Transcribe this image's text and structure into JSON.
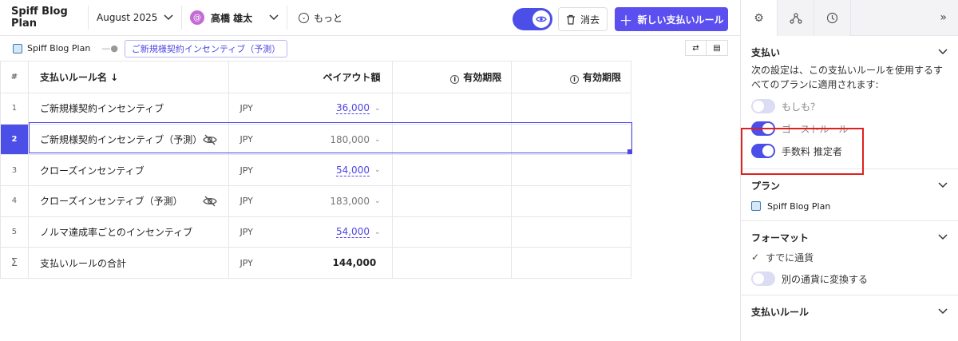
{
  "topbar": {
    "title": "Spiff Blog Plan",
    "month": "August 2025",
    "user_name": "高橋 雄太",
    "more_label": "もっと",
    "delete_label": "消去",
    "new_rule_label": "新しい支払いルール"
  },
  "breadcrumb": {
    "plan": "Spiff Blog Plan",
    "current": "ご新規様契約インセンティブ（予測）"
  },
  "table": {
    "headers": {
      "num": "#",
      "name": "支払いルール名 ↓",
      "payout": "ペイアウト額",
      "valid1": "有効期限",
      "valid2": "有効期限"
    },
    "rows": [
      {
        "num": "1",
        "name": "ご新規様契約インセンティブ",
        "currency": "JPY",
        "amount": "36,000"
      },
      {
        "num": "2",
        "name": "ご新規様契約インセンティブ（予測）",
        "currency": "JPY",
        "amount": "180,000"
      },
      {
        "num": "3",
        "name": "クローズインセンティブ",
        "currency": "JPY",
        "amount": "54,000"
      },
      {
        "num": "4",
        "name": "クローズインセンティブ（予測）",
        "currency": "JPY",
        "amount": "183,000"
      },
      {
        "num": "5",
        "name": "ノルマ達成率ごとのインセンティブ",
        "currency": "JPY",
        "amount": "54,000"
      }
    ],
    "total": {
      "symbol": "Σ",
      "name": "支払いルールの合計",
      "currency": "JPY",
      "amount": "144,000"
    }
  },
  "panel": {
    "payment": {
      "title": "支払い",
      "description": "次の設定は、この支払いルールを使用するすべてのプランに適用されます:",
      "toggles": [
        {
          "label": "もしも？",
          "on": false
        },
        {
          "label": "ゴーストルール",
          "on": true
        },
        {
          "label": "手数料 推定者",
          "on": true
        }
      ]
    },
    "plan": {
      "title": "プラン",
      "item": "Spiff Blog Plan"
    },
    "format": {
      "title": "フォーマット",
      "check_label": "すでに通貨",
      "convert_label": "別の通貨に変換する"
    },
    "rules": {
      "title": "支払いルール"
    }
  },
  "colors": {
    "accent": "#4c4ee8",
    "highlight_box": "#e0201f"
  }
}
